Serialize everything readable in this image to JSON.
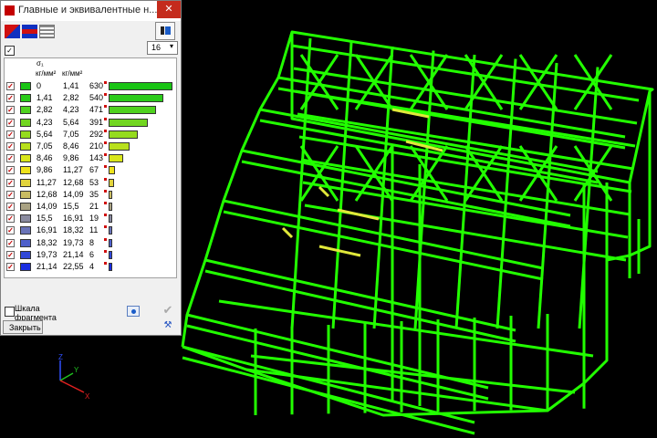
{
  "window": {
    "title": "Главные и эквивалентные н...",
    "close_glyph": "✕"
  },
  "toolbar": {
    "icons": [
      "red-blue-palette-icon",
      "stripes-palette-icon",
      "grid-palette-icon",
      "layout-icon"
    ]
  },
  "controls": {
    "select_all_checked": true,
    "check_glyph": "✓",
    "interval_count": "16"
  },
  "legend": {
    "header_symbol": "σ₁",
    "header_unit_from": "кг/мм²",
    "header_unit_to": "кг/мм²",
    "rows": [
      {
        "from": "0",
        "to": "1,41",
        "count": "630",
        "color": "#19c414",
        "fraction": 1.0
      },
      {
        "from": "1,41",
        "to": "2,82",
        "count": "540",
        "color": "#2bcb1a",
        "fraction": 0.857
      },
      {
        "from": "2,82",
        "to": "4,23",
        "count": "471",
        "color": "#4fd21f",
        "fraction": 0.748
      },
      {
        "from": "4,23",
        "to": "5,64",
        "count": "391",
        "color": "#72d620",
        "fraction": 0.621
      },
      {
        "from": "5,64",
        "to": "7,05",
        "count": "292",
        "color": "#95db1e",
        "fraction": 0.463
      },
      {
        "from": "7,05",
        "to": "8,46",
        "count": "210",
        "color": "#b8e01c",
        "fraction": 0.333
      },
      {
        "from": "8,46",
        "to": "9,86",
        "count": "143",
        "color": "#d9e61a",
        "fraction": 0.227
      },
      {
        "from": "9,86",
        "to": "11,27",
        "count": "67",
        "color": "#eee31c",
        "fraction": 0.106
      },
      {
        "from": "11,27",
        "to": "12,68",
        "count": "53",
        "color": "#e2d43c",
        "fraction": 0.084
      },
      {
        "from": "12,68",
        "to": "14,09",
        "count": "35",
        "color": "#c9bc62",
        "fraction": 0.056
      },
      {
        "from": "14,09",
        "to": "15,5",
        "count": "21",
        "color": "#a9a283",
        "fraction": 0.033
      },
      {
        "from": "15,5",
        "to": "16,91",
        "count": "19",
        "color": "#8a8ba0",
        "fraction": 0.03
      },
      {
        "from": "16,91",
        "to": "18,32",
        "count": "11",
        "color": "#6a74b8",
        "fraction": 0.017
      },
      {
        "from": "18,32",
        "to": "19,73",
        "count": "8",
        "color": "#4e5fca",
        "fraction": 0.013
      },
      {
        "from": "19,73",
        "to": "21,14",
        "count": "6",
        "color": "#3148d8",
        "fraction": 0.01
      },
      {
        "from": "21,14",
        "to": "22,55",
        "count": "4",
        "color": "#1a2de0",
        "fraction": 0.006
      }
    ]
  },
  "scale": {
    "label": "Шкала фрагмента",
    "checked": false
  },
  "buttons": {
    "close": "Закрыть",
    "apply_glyph": "✔",
    "tools_glyph": "⚒"
  },
  "axes": {
    "x": "X",
    "y": "Y",
    "z": "Z"
  },
  "colors": {
    "model": "#22ff00",
    "highlight": "#e0e83a",
    "background": "#000000"
  }
}
